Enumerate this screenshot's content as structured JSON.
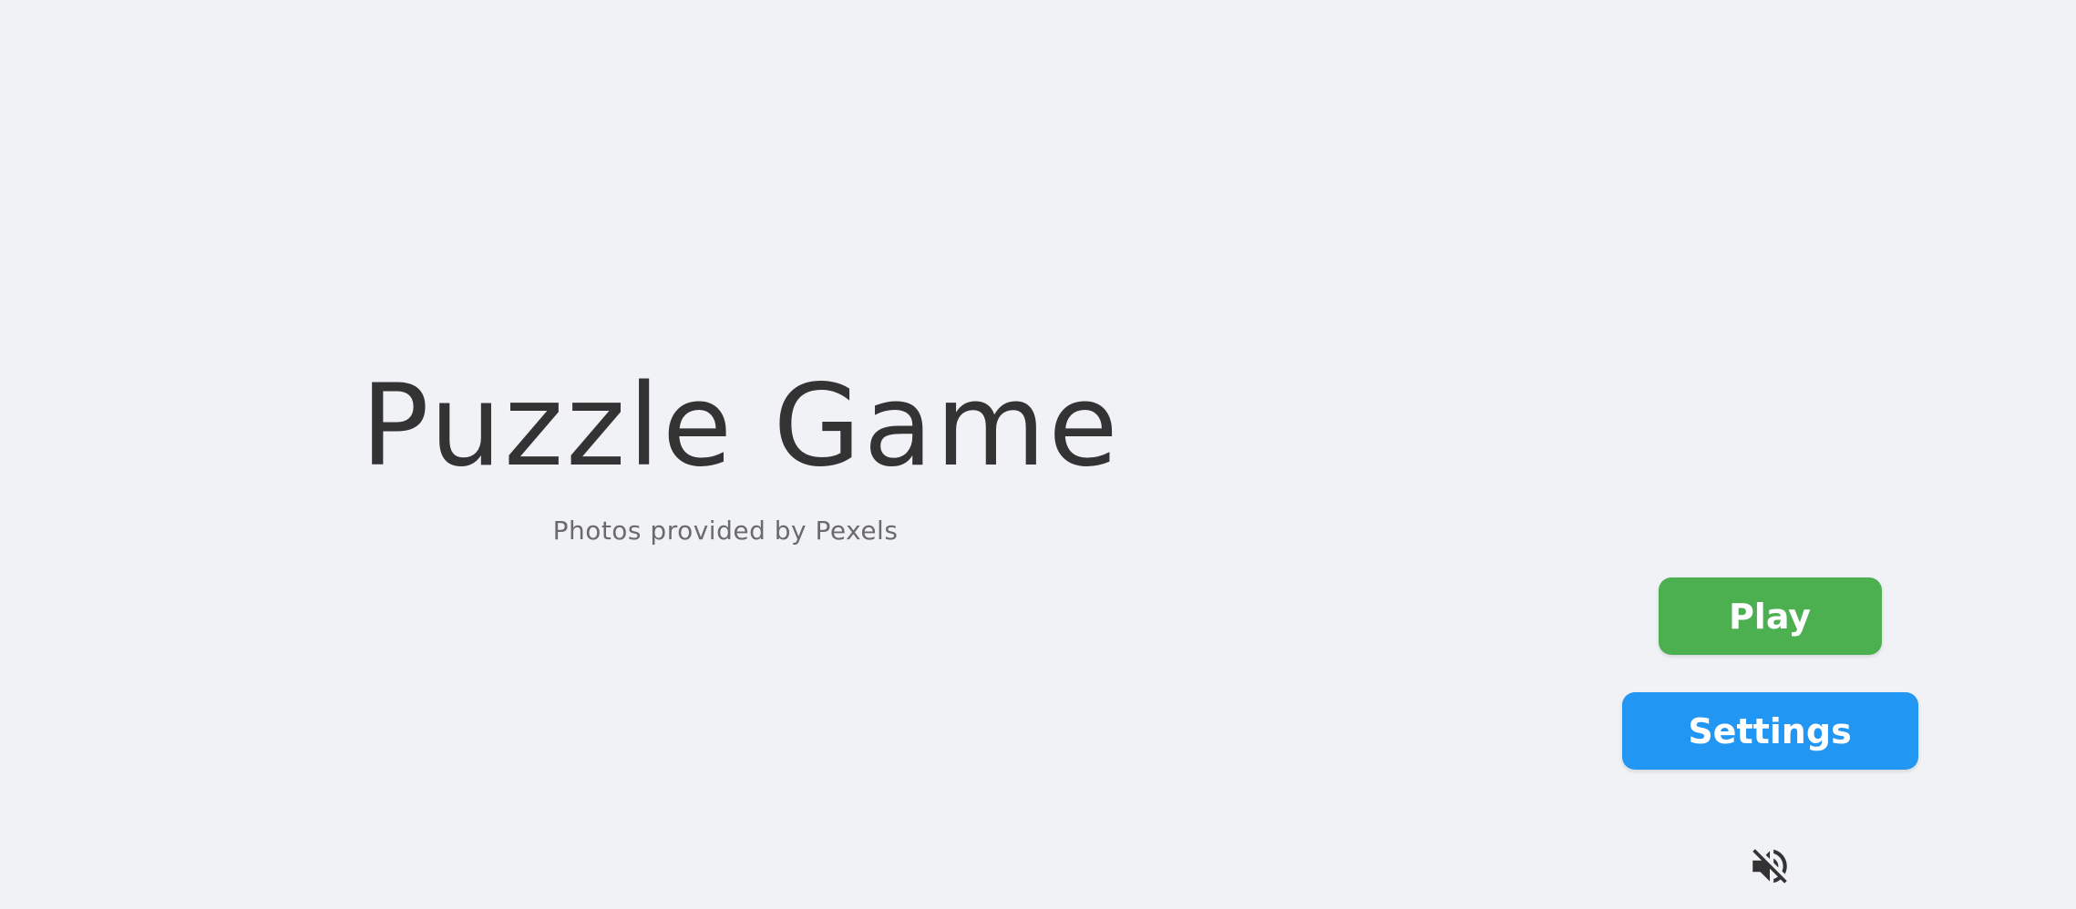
{
  "title": "Puzzle Game",
  "credit": "Photos provided by Pexels",
  "menu": {
    "play_label": "Play",
    "settings_label": "Settings",
    "sound_icon": "volume-off-icon"
  },
  "colors": {
    "background": "#f0f2f6",
    "title_text": "#333333",
    "credit_text": "#6b6b6b",
    "play_button": "#4caf50",
    "settings_button": "#2196f3",
    "icon": "#333333"
  }
}
